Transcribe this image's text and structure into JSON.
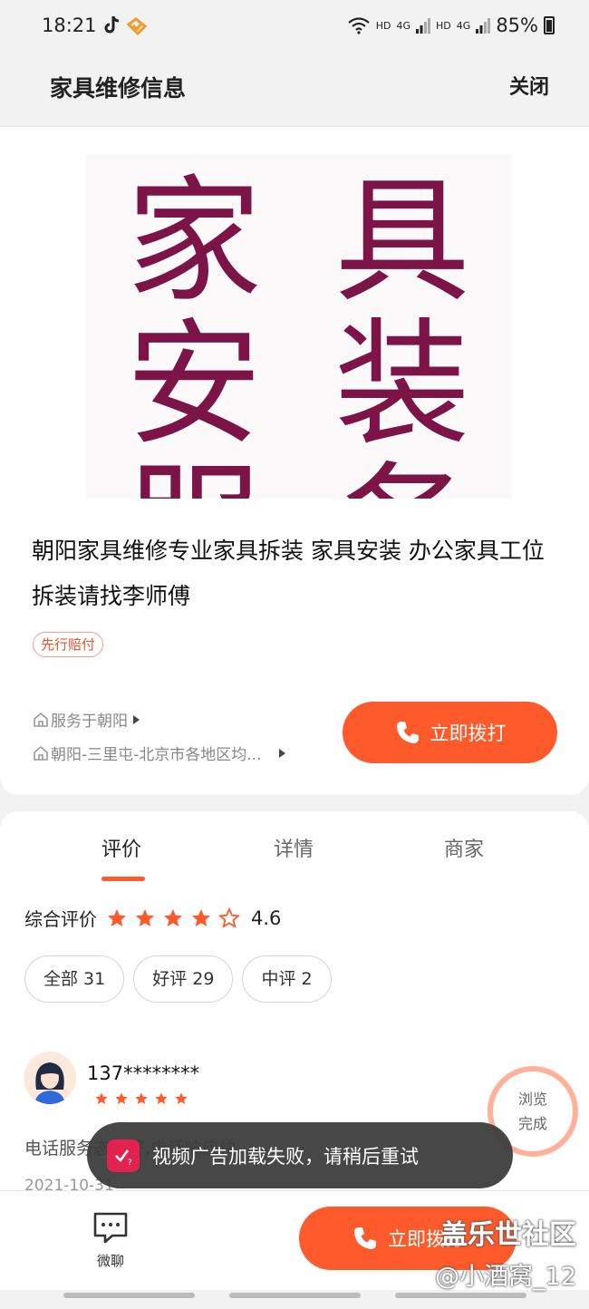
{
  "status_bar": {
    "time": "18:21",
    "network_1": "HD",
    "network_2": "4G",
    "network_3": "HD",
    "network_4": "4G",
    "battery": "85%"
  },
  "nav": {
    "title": "家具维修信息",
    "close_label": "关闭"
  },
  "hero_image": {
    "chars": [
      "家",
      "具",
      "安",
      "装",
      "服",
      "务"
    ]
  },
  "listing": {
    "title": "朝阳家具维修专业家具拆装 家具安装 办公家具工位拆装请找李师傅",
    "badge": "先行赔付",
    "service_area": "服务于朝阳",
    "location": "朝阳-三里屯-北京市各地区均...",
    "call_label": "立即拨打"
  },
  "tabs": [
    "评价",
    "详情",
    "商家"
  ],
  "rating": {
    "label": "综合评价",
    "score": "4.6",
    "stars_filled": 4,
    "stars_total": 5
  },
  "filters": [
    "全部 31",
    "好评 29",
    "中评 2"
  ],
  "review": {
    "user": "137********",
    "stars": 5,
    "text": "电话服务态度好,电话响应快",
    "date": "2021-10-31"
  },
  "browse_badge": {
    "line1": "浏览",
    "line2": "完成"
  },
  "bottom_bar": {
    "chat_label": "微聊",
    "call_label": "立即拨打"
  },
  "toast": {
    "message": "视频广告加载失败，请稍后重试"
  },
  "watermark": {
    "line1": "盖乐世社区",
    "line2": "@小酒窝_12"
  },
  "colors": {
    "accent": "#ff5a2b",
    "hero_text": "#7c1447",
    "toast_bg": "#3c3c3c"
  }
}
